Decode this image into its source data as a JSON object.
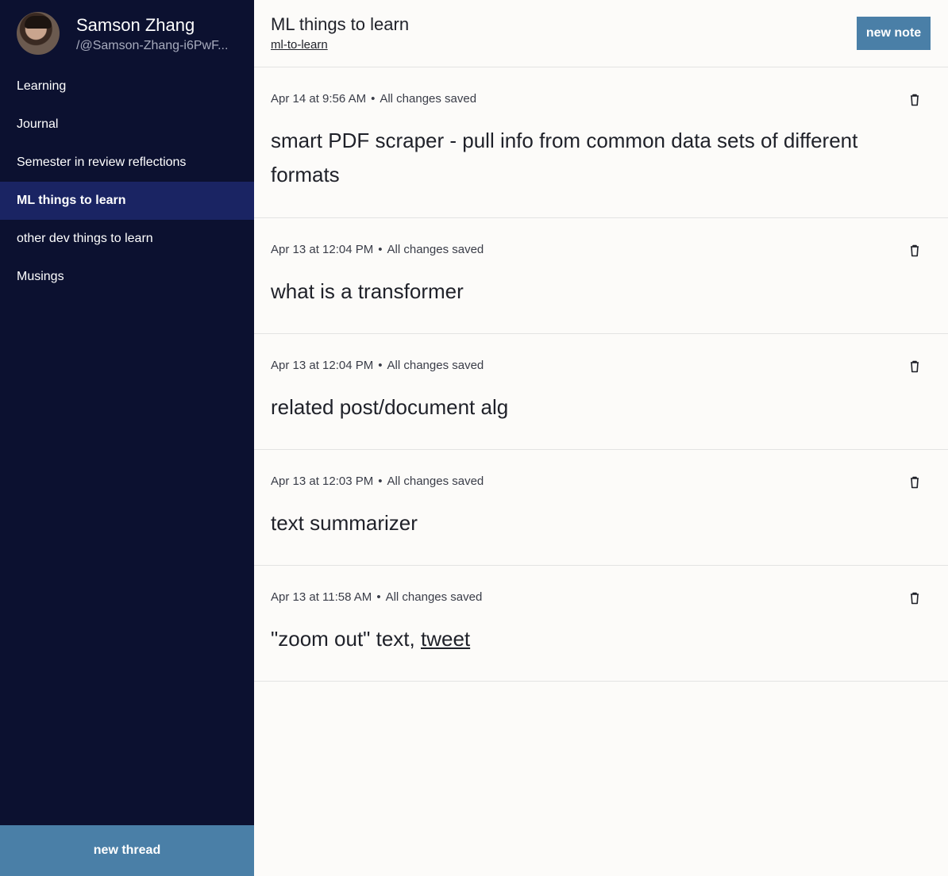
{
  "profile": {
    "name": "Samson Zhang",
    "handle": "/@Samson-Zhang-i6PwF..."
  },
  "sidebar": {
    "items": [
      {
        "label": "Learning"
      },
      {
        "label": "Journal"
      },
      {
        "label": "Semester in review reflections"
      },
      {
        "label": "ML things to learn",
        "active": true
      },
      {
        "label": "other dev things to learn"
      },
      {
        "label": "Musings"
      }
    ],
    "new_thread_label": "new thread"
  },
  "header": {
    "title": "ML things to learn",
    "slug": "ml-to-learn",
    "new_note_label": "new note"
  },
  "notes": [
    {
      "date": "Apr 14 at 9:56 AM",
      "status": "All changes saved",
      "text": "smart PDF scraper - pull info from common data sets of different formats"
    },
    {
      "date": "Apr 13 at 12:04 PM",
      "status": "All changes saved",
      "text": "what is a transformer"
    },
    {
      "date": "Apr 13 at 12:04 PM",
      "status": "All changes saved",
      "text": "related post/document alg"
    },
    {
      "date": "Apr 13 at 12:03 PM",
      "status": "All changes saved",
      "text": "text summarizer"
    },
    {
      "date": "Apr 13 at 11:58 AM",
      "status": "All changes saved",
      "text_before": "\"zoom out\" text, ",
      "link": "tweet"
    }
  ],
  "separator": "•",
  "icons": {
    "trash": "trash-icon"
  },
  "colors": {
    "sidebar_bg": "#0c1130",
    "sidebar_active": "#1a2463",
    "accent_button": "#4a7fa7",
    "main_bg": "#fcfbf9"
  }
}
